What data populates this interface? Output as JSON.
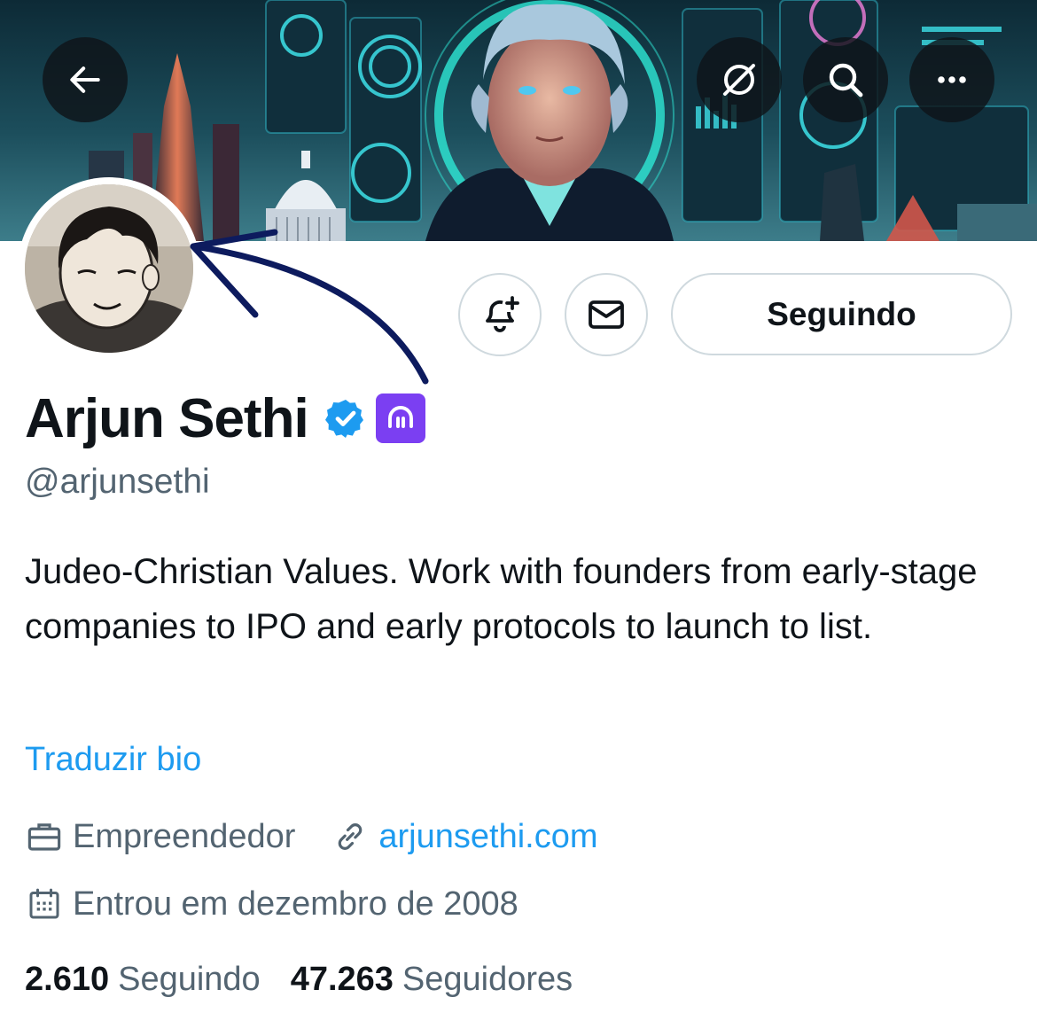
{
  "banner": {
    "icon": "banner-illustration"
  },
  "nav": {
    "back_icon": "arrow-left-icon",
    "grok_icon": "grok-icon",
    "search_icon": "search-icon",
    "more_icon": "more-icon"
  },
  "avatar": {
    "icon": "avatar"
  },
  "actions": {
    "notify_icon": "bell-plus-icon",
    "message_icon": "envelope-icon",
    "follow_label": "Seguindo"
  },
  "profile": {
    "display_name": "Arjun Sethi",
    "handle": "@arjunsethi",
    "verified_color": "#1d9bf0",
    "affiliate_color": "#7b3ff2",
    "bio": "Judeo-Christian Values. Work with founders from early-stage companies to IPO and early protocols to launch to list.",
    "translate_label": "Traduzir bio",
    "profession": "Empreendedor",
    "website": "arjunsethi.com",
    "joined": "Entrou em dezembro de 2008"
  },
  "stats": {
    "following_count": "2.610",
    "following_label": "Seguindo",
    "followers_count": "47.263",
    "followers_label": "Seguidores"
  },
  "colors": {
    "text_primary": "#0f1419",
    "text_secondary": "#536471",
    "link": "#1d9bf0",
    "border": "#cfd9de",
    "annotation_arrow": "#0d1b5e"
  }
}
